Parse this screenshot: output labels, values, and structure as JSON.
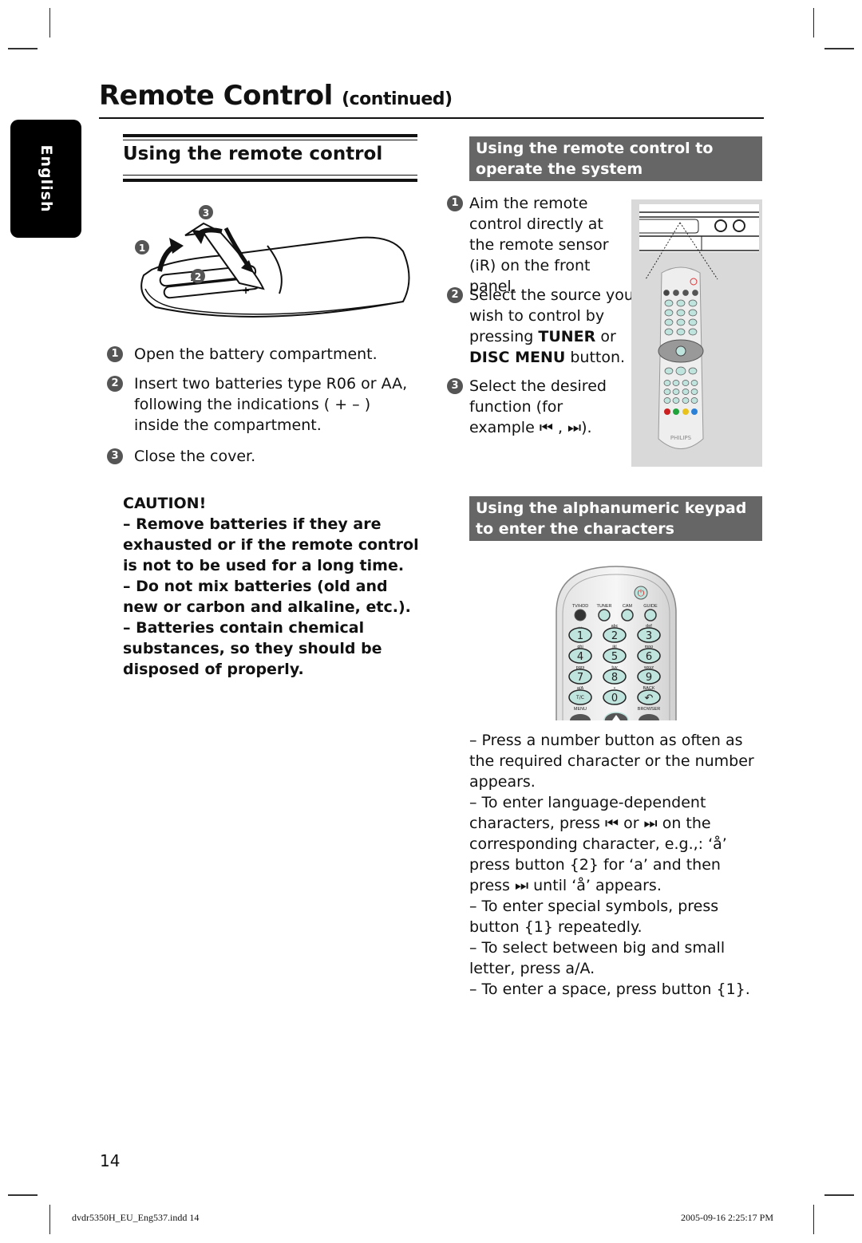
{
  "header": {
    "title": "Remote Control",
    "title_suffix": "(continued)",
    "language_tab": "English"
  },
  "left_section": {
    "title": "Using the remote control",
    "illustration": {
      "name": "battery-compartment-illustration",
      "callouts": [
        "1",
        "2",
        "3"
      ]
    },
    "steps": [
      {
        "num": "1",
        "text": "Open the battery compartment."
      },
      {
        "num": "2",
        "text": "Insert two batteries type R06 or AA, following the indications ( + – ) inside the compartment."
      },
      {
        "num": "3",
        "text": "Close the cover."
      }
    ],
    "caution": {
      "title": "CAUTION!",
      "items": [
        "– Remove batteries if they are exhausted or if the remote control is not to be used for a long time.",
        "– Do not mix batteries (old and new or carbon and alkaline, etc.).",
        "– Batteries contain chemical substances, so they should be disposed of properly."
      ]
    }
  },
  "right_section_1": {
    "title": "Using the remote control to operate the system",
    "steps": [
      {
        "num": "1",
        "text": "Aim the remote control directly at the remote sensor (iR) on the front panel."
      },
      {
        "num": "2",
        "text_pre": "Select the source you wish to control by pressing ",
        "bold1": "TUNER",
        "mid": " or ",
        "bold2": "DISC MENU",
        "text_post": " button."
      },
      {
        "num": "3",
        "text": "Select the desired function (for example ⏮ , ⏭)."
      }
    ],
    "illustration": {
      "name": "remote-pointing-at-recorder-illustration",
      "brand": "PHILIPS",
      "color_keys": [
        "#cc1f1f",
        "#1fa33a",
        "#e8c21a",
        "#2a7fd6"
      ]
    }
  },
  "right_section_2": {
    "title": "Using the alphanumeric keypad to enter the characters",
    "keypad": {
      "top_buttons": [
        "TV/HDD",
        "TUNER",
        "CAM",
        "GUIDE"
      ],
      "keys": [
        {
          "label": "1",
          "sub": "␣"
        },
        {
          "label": "2",
          "sub": "abc"
        },
        {
          "label": "3",
          "sub": "def"
        },
        {
          "label": "4",
          "sub": "ghi"
        },
        {
          "label": "5",
          "sub": "jkl"
        },
        {
          "label": "6",
          "sub": "mno"
        },
        {
          "label": "7",
          "sub": "pqrs"
        },
        {
          "label": "8",
          "sub": "tuv"
        },
        {
          "label": "9",
          "sub": "wxyz"
        },
        {
          "label": "T/C",
          "sub": "a/A"
        },
        {
          "label": "0",
          "sub": "•"
        },
        {
          "label": "↶",
          "sub": "BACK"
        }
      ],
      "bottom_labels": [
        "MENU",
        "BROWSER"
      ]
    },
    "bullets": [
      "–  Press a number button as often as the required character or the number appears.",
      "–  To enter language-dependent characters, press ⏮ or ⏭ on the corresponding character, e.g.,: ‘å’ press button {2} for ‘a’ and then press ⏭ until ‘å’ appears.",
      "–  To enter special symbols, press button {1} repeatedly.",
      "–  To select between big and small letter, press a/A.",
      "–  To enter a space, press button {1}."
    ]
  },
  "footer": {
    "page_number": "14",
    "file": "dvdr5350H_EU_Eng537.indd   14",
    "timestamp": "2005-09-16   2:25:17 PM"
  },
  "colors": {
    "header_bar": "#666666",
    "step_badge": "#555555",
    "illustration_bg": "#d9d9d9",
    "keypad_key": "#bfe3dd"
  }
}
